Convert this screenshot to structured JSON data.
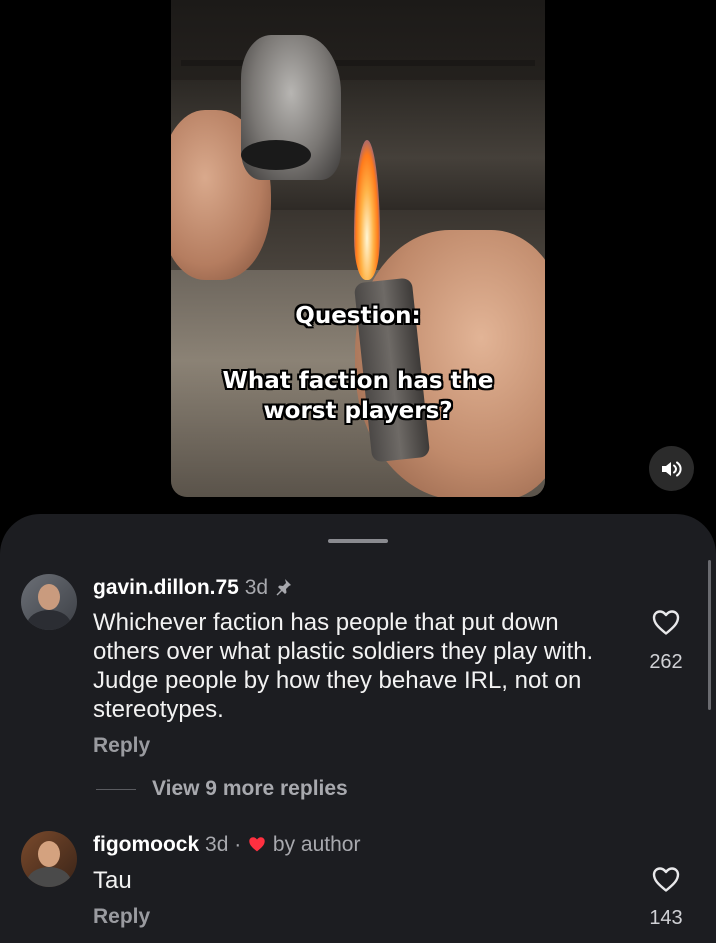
{
  "video": {
    "caption_question": "Question:",
    "caption_text_line1": "What faction has the",
    "caption_text_line2": "worst players?",
    "sound_icon": "speaker-on-icon"
  },
  "comments": [
    {
      "username": "gavin.dillon.75",
      "age": "3d",
      "pinned": true,
      "text": "Whichever faction has people that put down others over what plastic soldiers they play with. Judge people by how they behave IRL, not on stereotypes.",
      "reply_label": "Reply",
      "likes": "262",
      "view_more": "View 9 more replies"
    },
    {
      "username": "figomoock",
      "age": "3d",
      "separator": "·",
      "liked_by_author_label": "by author",
      "text": "Tau",
      "reply_label": "Reply",
      "likes": "143"
    }
  ],
  "colors": {
    "sheet_bg": "#1c1d21",
    "author_heart": "#ff3040"
  }
}
